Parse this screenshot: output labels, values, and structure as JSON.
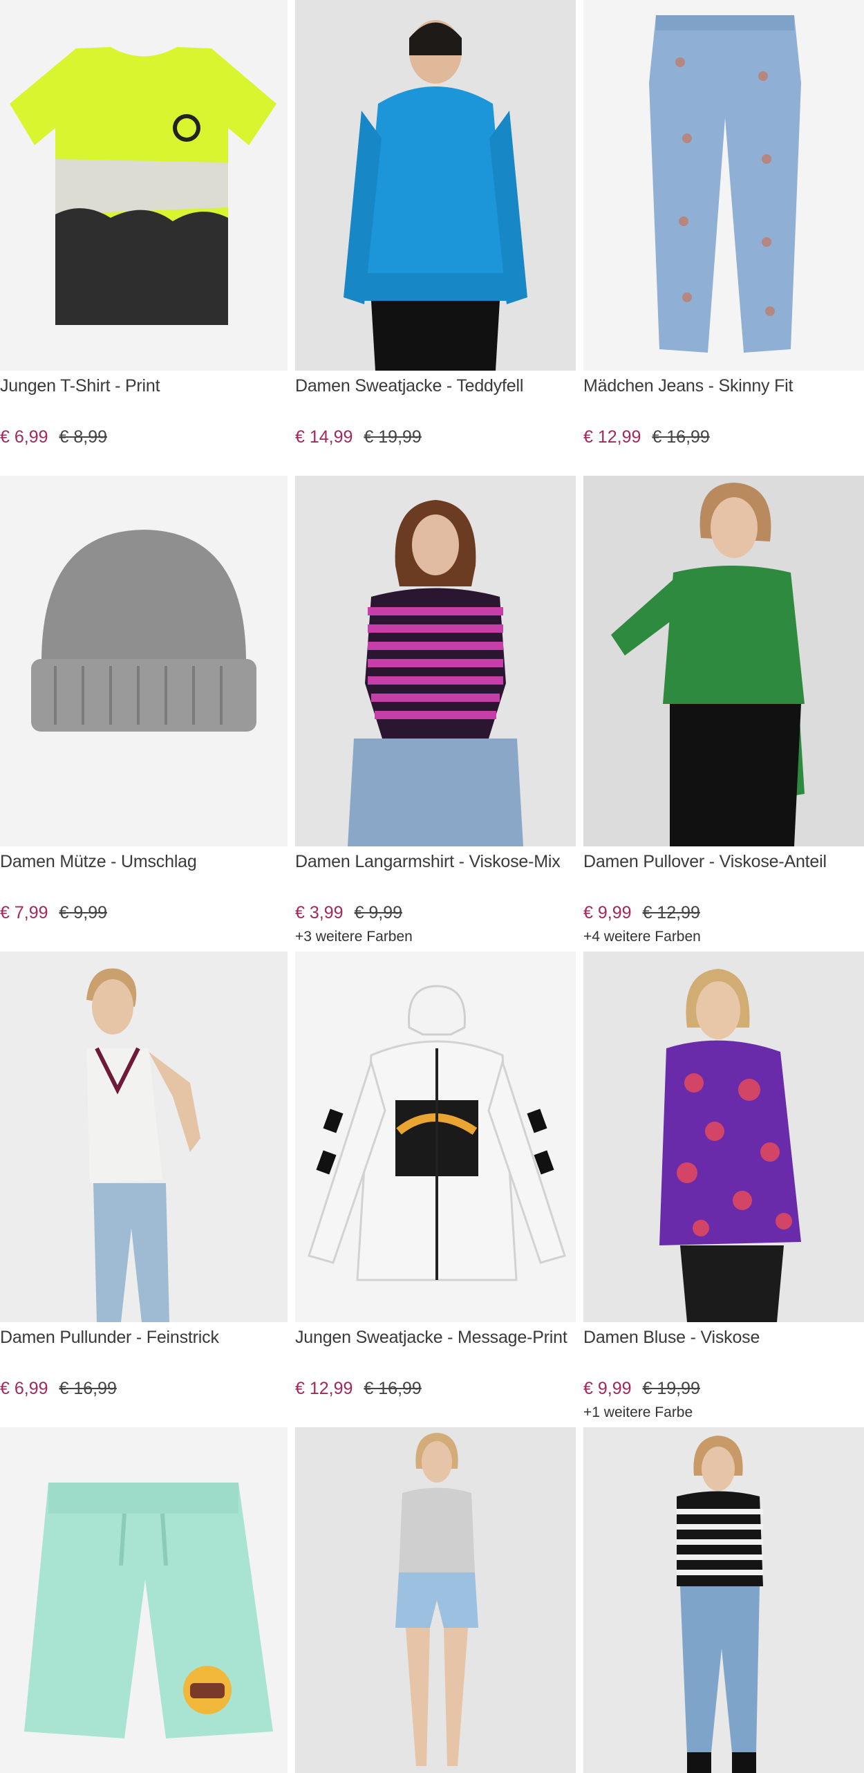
{
  "currency": "€",
  "products": [
    {
      "title": "Jungen T-Shirt - Print",
      "price": "€ 6,99",
      "old_price": "€ 8,99",
      "colors": "",
      "icon": "tshirt-icon"
    },
    {
      "title": "Damen Sweatjacke - Teddyfell",
      "price": "€ 14,99",
      "old_price": "€ 19,99",
      "colors": "",
      "icon": "fleece-jacket-icon"
    },
    {
      "title": "Mädchen Jeans - Skinny Fit",
      "price": "€ 12,99",
      "old_price": "€ 16,99",
      "colors": "",
      "icon": "jeans-icon"
    },
    {
      "title": "Damen Mütze - Umschlag",
      "price": "€ 7,99",
      "old_price": "€ 9,99",
      "colors": "",
      "icon": "beanie-icon"
    },
    {
      "title": "Damen Langarmshirt - Viskose-Mix",
      "price": "€ 3,99",
      "old_price": "€ 9,99",
      "colors": "+3 weitere Farben",
      "icon": "striped-shirt-icon"
    },
    {
      "title": "Damen Pullover - Viskose-Anteil",
      "price": "€ 9,99",
      "old_price": "€ 12,99",
      "colors": "+4 weitere Farben",
      "icon": "green-sweater-icon"
    },
    {
      "title": "Damen Pullunder - Feinstrick",
      "price": "€ 6,99",
      "old_price": "€ 16,99",
      "colors": "",
      "icon": "sweater-vest-icon"
    },
    {
      "title": "Jungen Sweatjacke - Message-Print",
      "price": "€ 12,99",
      "old_price": "€ 16,99",
      "colors": "",
      "icon": "hoodie-icon"
    },
    {
      "title": "Damen Bluse - Viskose",
      "price": "€ 9,99",
      "old_price": "€ 19,99",
      "colors": "+1 weitere Farbe",
      "icon": "blouse-icon"
    },
    {
      "title": "",
      "price": "",
      "old_price": "",
      "colors": "",
      "icon": "shorts-icon"
    },
    {
      "title": "",
      "price": "",
      "old_price": "",
      "colors": "",
      "icon": "model-shorts-icon"
    },
    {
      "title": "",
      "price": "",
      "old_price": "",
      "colors": "",
      "icon": "striped-sweater-icon"
    }
  ],
  "colors": {
    "price": "#a3285b",
    "image_bg": "#eeeeee"
  }
}
